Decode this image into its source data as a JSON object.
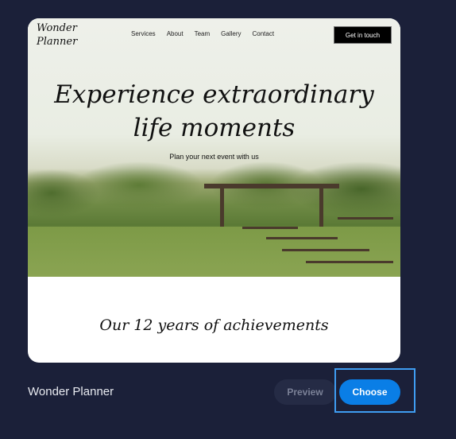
{
  "template": {
    "site_logo": "Wonder Planner",
    "nav": [
      "Services",
      "About",
      "Team",
      "Gallery",
      "Contact"
    ],
    "cta": "Get in touch",
    "headline_line1": "Experience extraordinary",
    "headline_line2": "life moments",
    "subheadline": "Plan your next event with us",
    "section_title": "Our 12 years of achievements"
  },
  "footer": {
    "template_name": "Wonder Planner",
    "preview_label": "Preview",
    "choose_label": "Choose"
  },
  "colors": {
    "background": "#1b2039",
    "accent": "#0a7ee6",
    "focus_ring": "#3f9df2"
  }
}
